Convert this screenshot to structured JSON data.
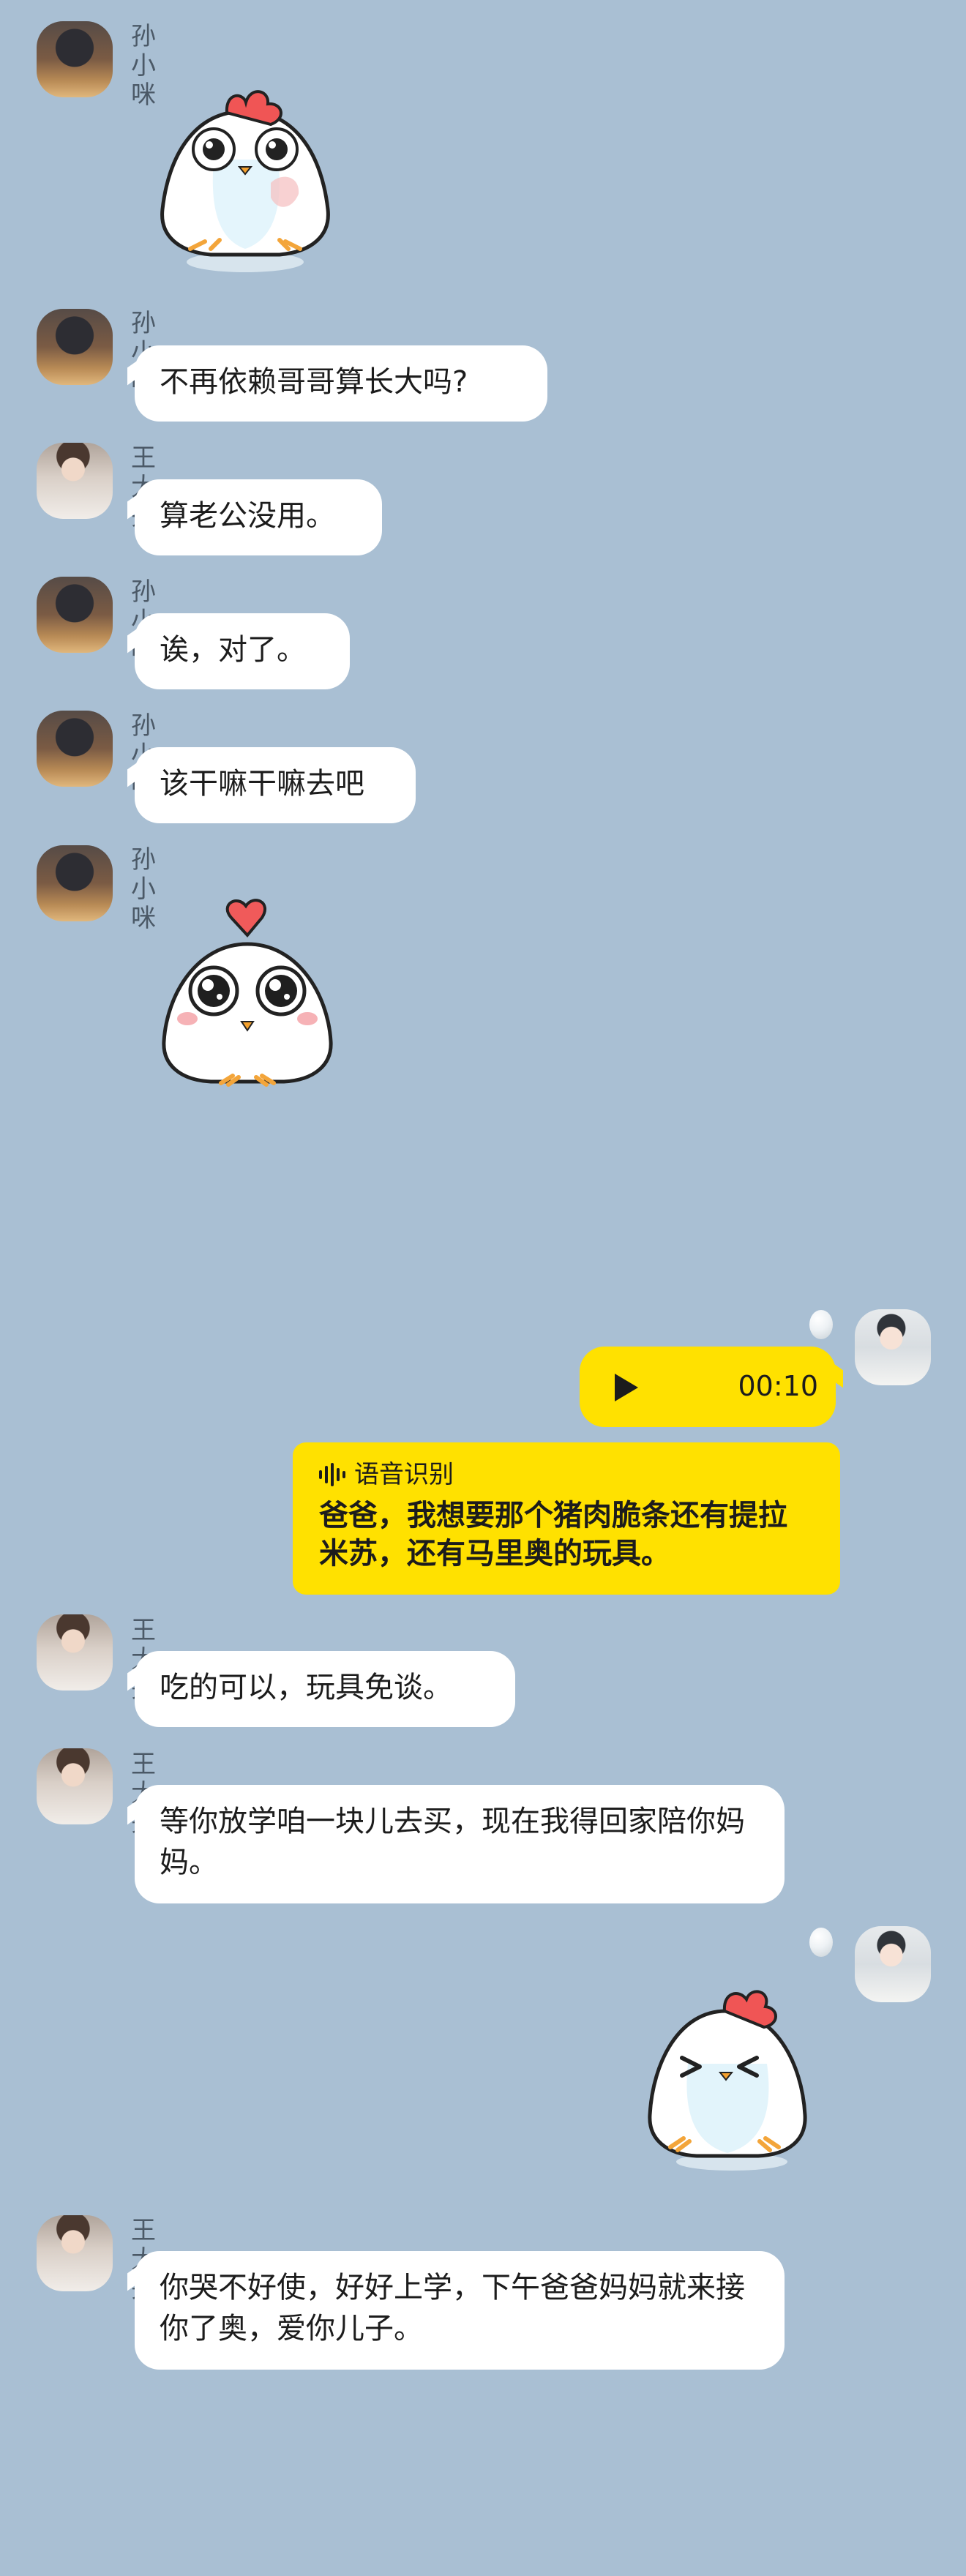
{
  "colors": {
    "background": "#a9bfd3",
    "bubble_incoming": "#ffffff",
    "bubble_outgoing": "#ffe100"
  },
  "messages": {
    "m1": {
      "sender": "孙小咪",
      "type": "sticker",
      "sticker": "chick-sticker-blush"
    },
    "m2": {
      "sender": "孙小咪",
      "text": "不再依赖哥哥算长大吗?"
    },
    "m3": {
      "sender": "王大头",
      "text": "算老公没用。"
    },
    "m4": {
      "sender": "孙小咪",
      "text": "诶，对了。"
    },
    "m5": {
      "sender": "孙小咪",
      "text": "该干嘛干嘛去吧"
    },
    "m6": {
      "sender": "孙小咪",
      "type": "sticker",
      "sticker": "chick-sticker-heart"
    },
    "m7": {
      "type": "voice",
      "duration": "00:10",
      "recognition_label": "语音识别",
      "recognition_text": "爸爸，我想要那个猪肉脆条还有提拉米苏，还有马里奥的玩具。"
    },
    "m8": {
      "sender": "王大头",
      "text": "吃的可以，玩具免谈。"
    },
    "m9": {
      "sender": "王大头",
      "text": "等你放学咱一块儿去买，现在我得回家陪你妈妈。"
    },
    "m10": {
      "type": "sticker",
      "sticker": "chick-sticker-crying"
    },
    "m11": {
      "sender": "王大头",
      "text": "你哭不好使，好好上学，下午爸爸妈妈就来接你了奥，爱你儿子。"
    }
  }
}
